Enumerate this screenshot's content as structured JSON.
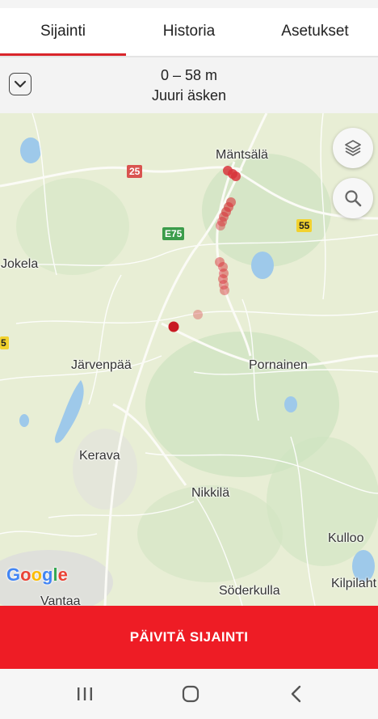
{
  "tabs": [
    {
      "label": "Sijainti",
      "active": true
    },
    {
      "label": "Historia",
      "active": false
    },
    {
      "label": "Asetukset",
      "active": false
    }
  ],
  "status": {
    "distance": "0 – 58 m",
    "time": "Juuri äsken"
  },
  "map": {
    "places": {
      "mantsala": "Mäntsälä",
      "jokela": "Jokela",
      "jarvenpaa": "Järvenpää",
      "pornainen": "Pornainen",
      "kerava": "Kerava",
      "nikkila": "Nikkilä",
      "kulloo": "Kulloo",
      "soderkulla": "Söderkulla",
      "kilpilahti": "Kilpilaht",
      "vantaa": "Vantaa"
    },
    "roads": {
      "r25": "25",
      "e75": "E75",
      "r55": "55",
      "r5": "5"
    },
    "logo": [
      "G",
      "o",
      "o",
      "g",
      "l",
      "e"
    ],
    "layers_icon": "layers-icon",
    "search_icon": "search-icon"
  },
  "actions": {
    "update_label": "PÄIVITÄ SIJAINTI"
  },
  "colors": {
    "accent": "#ee1c25",
    "tab_underline": "#d9252b"
  }
}
